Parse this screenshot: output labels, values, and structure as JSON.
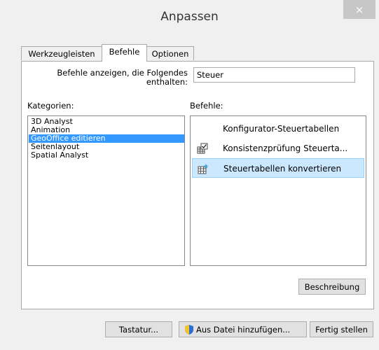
{
  "window": {
    "title": "Anpassen",
    "close_glyph": "×"
  },
  "tabs": [
    {
      "label": "Werkzeugleisten",
      "active": false
    },
    {
      "label": "Befehle",
      "active": true
    },
    {
      "label": "Optionen",
      "active": false
    }
  ],
  "filter": {
    "label_line1": "Befehle anzeigen, die Folgendes",
    "label_line2": "enthalten:",
    "value": "Steuer"
  },
  "categories": {
    "label": "Kategorien:",
    "items": [
      "3D Analyst",
      "Animation",
      "GeoOffice editieren",
      "Seitenlayout",
      "Spatial Analyst"
    ],
    "selected_index": 2
  },
  "commands": {
    "label": "Befehle:",
    "items": [
      {
        "label": "Konfigurator-Steuertabellen",
        "icon": "none"
      },
      {
        "label": "Konsistenzprüfung Steuerta...",
        "icon": "table-check-icon"
      },
      {
        "label": "Steuertabellen konvertieren",
        "icon": "table-convert-icon"
      }
    ],
    "selected_index": 2
  },
  "buttons": {
    "beschreibung": "Beschreibung",
    "tastatur": "Tastatur...",
    "aus_datei": "Aus Datei hinzufügen...",
    "fertig": "Fertig stellen"
  },
  "colors": {
    "selection": "#3399ff",
    "command_selection": "#cce8ff"
  }
}
